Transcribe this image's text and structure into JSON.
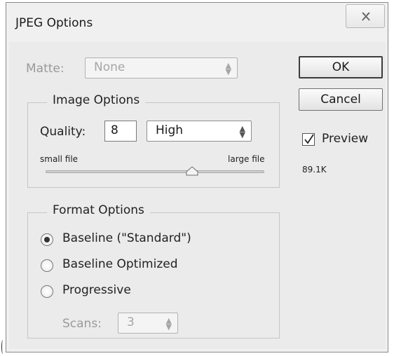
{
  "window": {
    "title": "JPEG Options",
    "close_glyph": "X"
  },
  "matte": {
    "label": "Matte:",
    "value": "None",
    "enabled": false
  },
  "image_options": {
    "title": "Image Options",
    "quality_label": "Quality:",
    "quality_value": "8",
    "quality_preset": "High",
    "slider_left_label": "small file",
    "slider_right_label": "large file",
    "slider_level": 0.67
  },
  "format_options": {
    "title": "Format Options",
    "radios": [
      {
        "label": "Baseline (\"Standard\")",
        "checked": true
      },
      {
        "label": "Baseline Optimized",
        "checked": false
      },
      {
        "label": "Progressive",
        "checked": false
      }
    ],
    "scans_label": "Scans:",
    "scans_value": "3"
  },
  "buttons": {
    "ok": "OK",
    "cancel": "Cancel"
  },
  "preview": {
    "label": "Preview",
    "checked": true,
    "size": "89.1K"
  }
}
